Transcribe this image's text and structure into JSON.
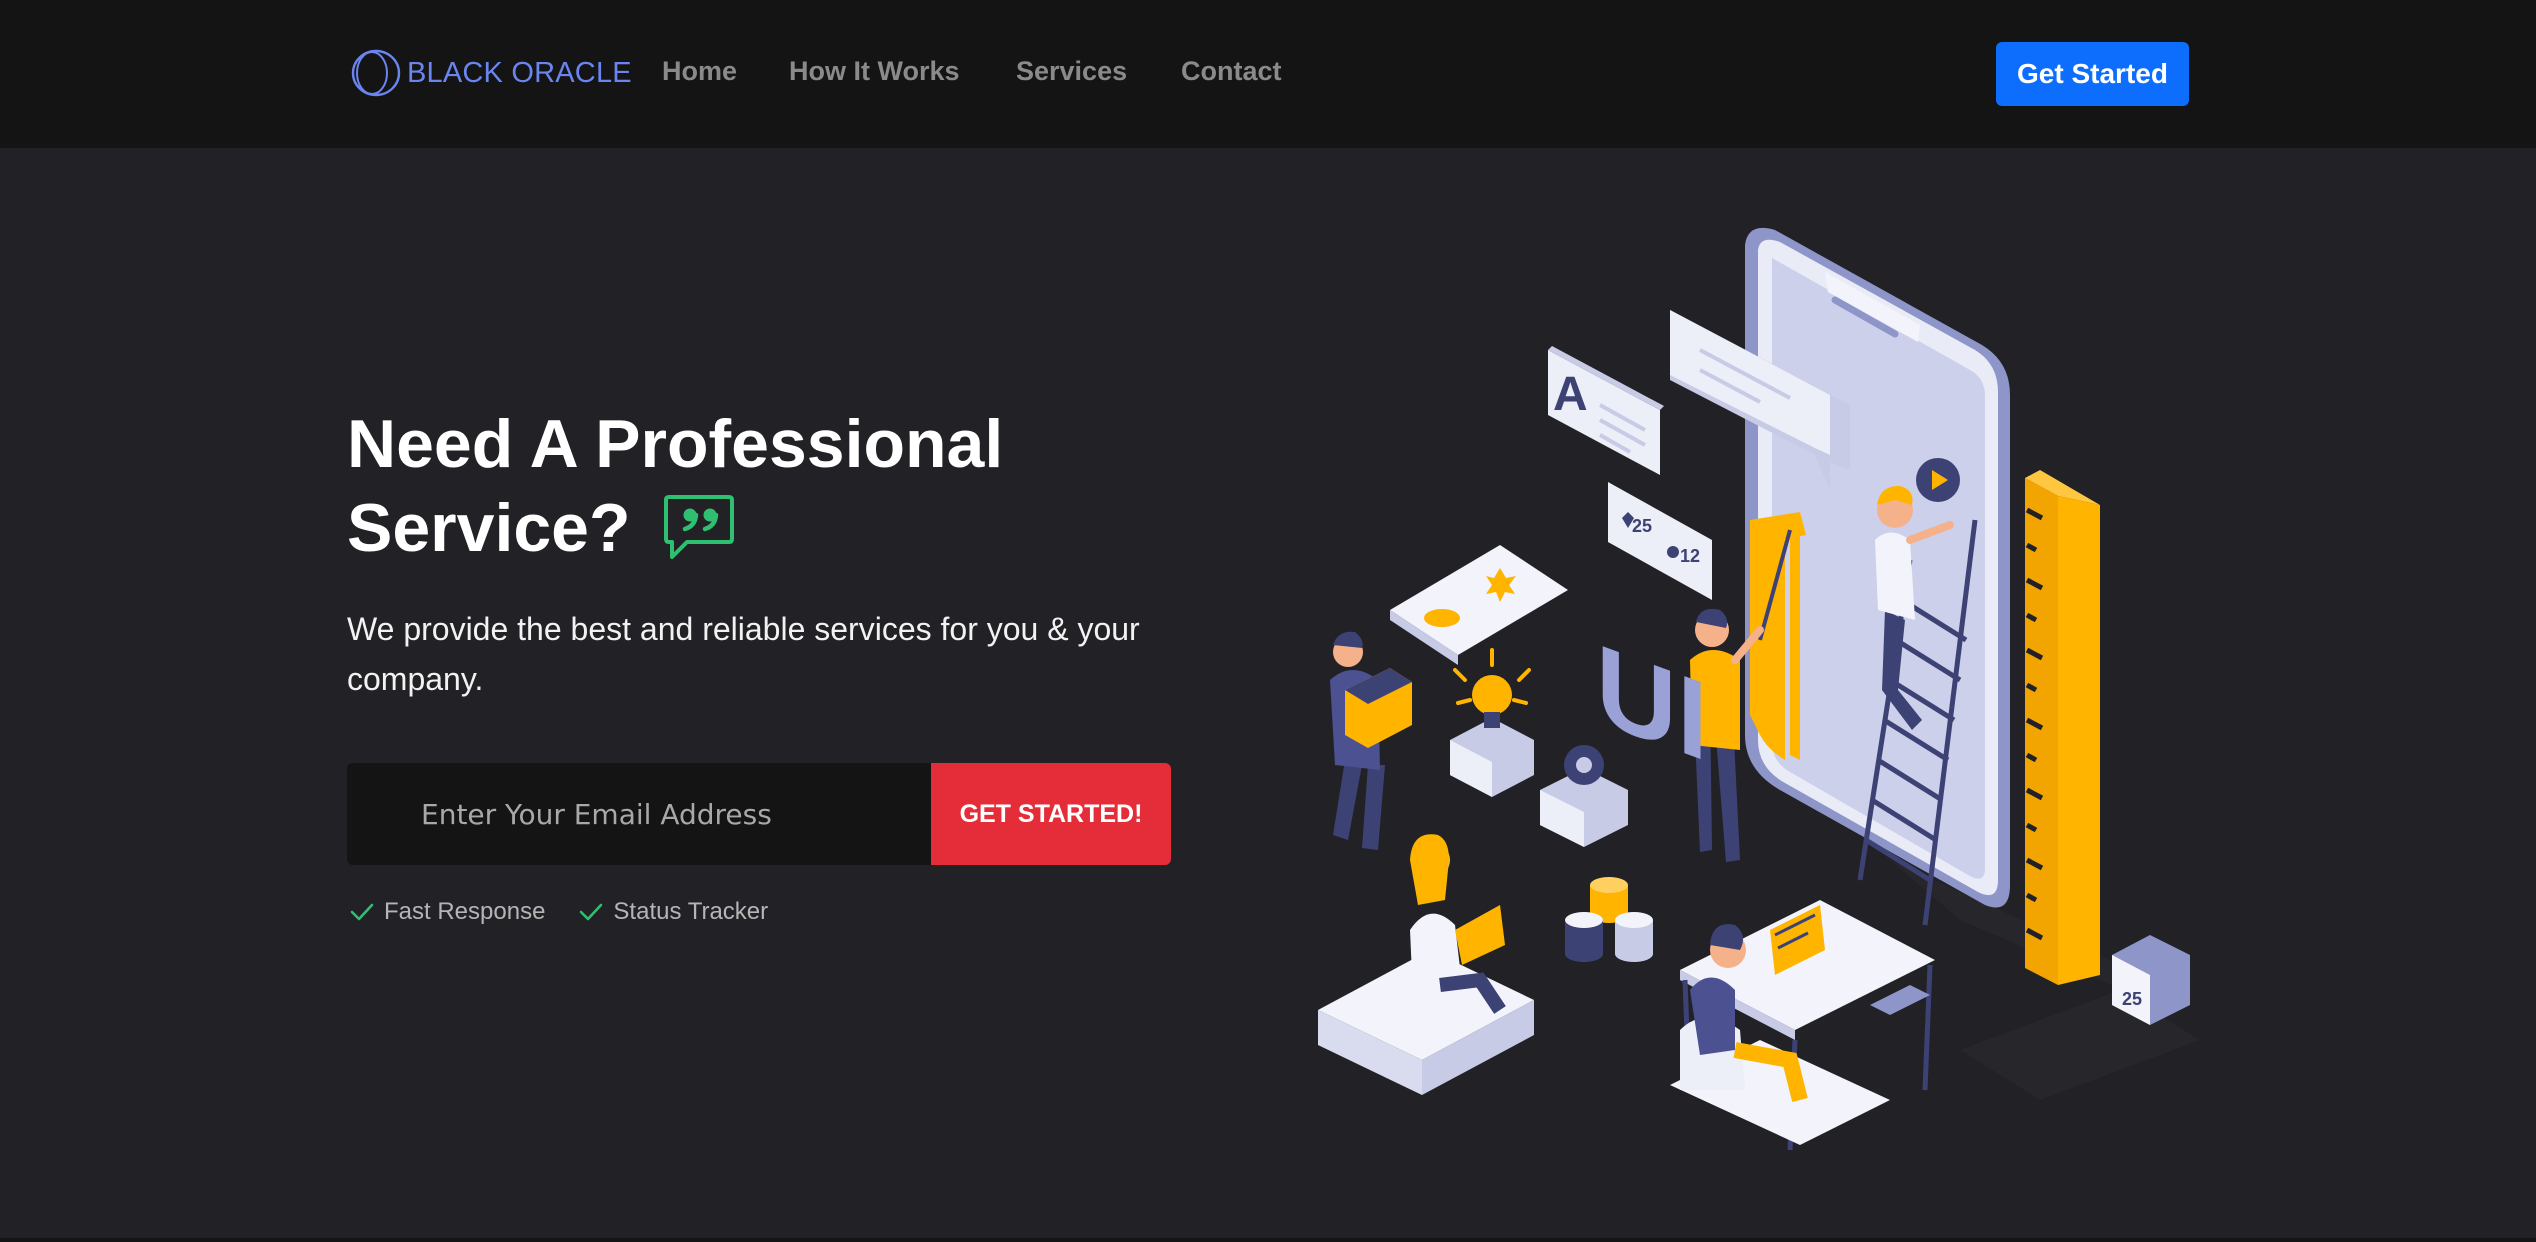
{
  "brand": {
    "name": "BLACK ORACLE",
    "logo_icon": "circle-logo-icon",
    "color": "#6b85f0"
  },
  "nav": {
    "links": [
      {
        "label": "Home"
      },
      {
        "label": "How It Works"
      },
      {
        "label": "Services"
      },
      {
        "label": "Contact"
      }
    ],
    "cta_label": "Get Started"
  },
  "hero": {
    "title_line1": "Need A Professional",
    "title_line2": "Service?",
    "title_icon": "quote-bubble-icon",
    "subtitle": "We provide the best and reliable services for you & your company.",
    "email_placeholder": "Enter Your Email Address",
    "submit_label": "GET STARTED!",
    "features": [
      {
        "icon": "check-icon",
        "label": "Fast Response"
      },
      {
        "icon": "check-icon",
        "label": "Status Tracker"
      }
    ],
    "illustration": {
      "icon": "isometric-app-team-illustration",
      "letter_card": "A",
      "big_letters": "UI",
      "likes": "25",
      "comments": "12",
      "calendar_day": "25"
    }
  },
  "colors": {
    "page_bg": "#222226",
    "nav_bg": "#141414",
    "primary": "#0d6efd",
    "danger": "#e52d3a",
    "success": "#2fbf71",
    "accent": "#ffb400"
  }
}
